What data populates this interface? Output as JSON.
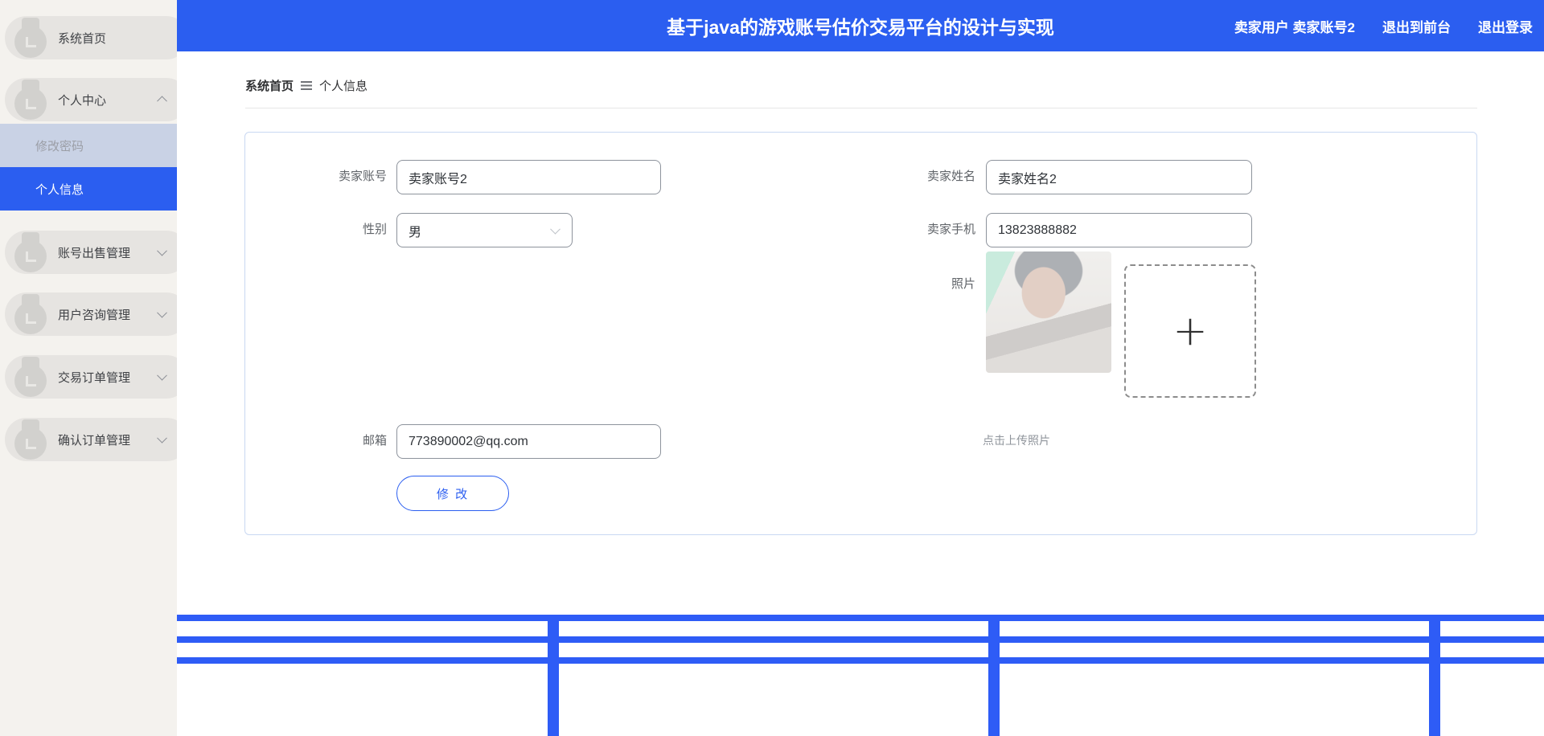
{
  "header": {
    "title": "基于java的游戏账号估价交易平台的设计与实现",
    "user": "卖家用户 卖家账号2",
    "exit_front_label": "退出到前台",
    "logout_label": "退出登录"
  },
  "sidebar": {
    "items": [
      {
        "label": "系统首页",
        "expandable": false
      },
      {
        "label": "个人中心",
        "expandable": true,
        "expanded": true
      },
      {
        "label": "账号出售管理",
        "expandable": true,
        "expanded": false
      },
      {
        "label": "用户咨询管理",
        "expandable": true,
        "expanded": false
      },
      {
        "label": "交易订单管理",
        "expandable": true,
        "expanded": false
      },
      {
        "label": "确认订单管理",
        "expandable": true,
        "expanded": false
      }
    ],
    "submenu": [
      {
        "label": "修改密码",
        "state": "disabled"
      },
      {
        "label": "个人信息",
        "state": "active"
      }
    ]
  },
  "breadcrumb": {
    "root": "系统首页",
    "current": "个人信息"
  },
  "form": {
    "account": {
      "label": "卖家账号",
      "value": "卖家账号2"
    },
    "name": {
      "label": "卖家姓名",
      "value": "卖家姓名2"
    },
    "gender": {
      "label": "性别",
      "value": "男"
    },
    "phone": {
      "label": "卖家手机",
      "value": "13823888882"
    },
    "photo": {
      "label": "照片",
      "hint": "点击上传照片",
      "plus": "+"
    },
    "email": {
      "label": "邮箱",
      "value": "773890002@qq.com"
    },
    "submit_label": "修 改"
  },
  "colors": {
    "brand_blue": "#2b5ef0",
    "grid_blue": "#2e5cf6",
    "sidebar_bg": "#f4f2ee",
    "pill_bg": "#e6e4e1",
    "submenu_disabled_bg": "#c9d2e5",
    "submenu_disabled_text": "#9b9ea6",
    "input_border": "#8d939c",
    "card_border": "#c9d8f2"
  }
}
